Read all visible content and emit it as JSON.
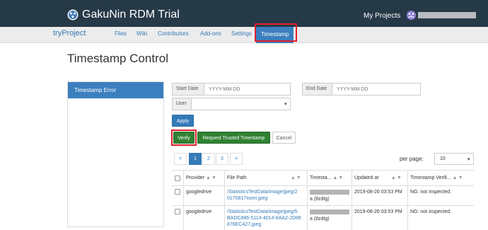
{
  "navbar": {
    "brand": "GakuNin RDM Trial",
    "my_projects": "My Projects",
    "user_name": ""
  },
  "subnav": {
    "project": "tryProject",
    "items": [
      "Files",
      "Wiki",
      "Contributors",
      "Add-ons",
      "Settings",
      "Timestamp"
    ],
    "active": "Timestamp"
  },
  "page": {
    "title": "Timestamp Control"
  },
  "sidebar": {
    "items": [
      {
        "label": "Timestamp Error"
      }
    ]
  },
  "filters": {
    "start_date_label": "Start Date",
    "start_date_placeholder": "YYYY-MM-DD",
    "end_date_label": "End Date",
    "end_date_placeholder": "YYYY-MM-DD",
    "user_label": "User",
    "user_value": ""
  },
  "buttons": {
    "apply": "Apply",
    "verify": "Verify",
    "request": "Request Trusted Timestamp",
    "cancel": "Cancel"
  },
  "pagination": {
    "prev": "<",
    "pages": [
      "1",
      "2",
      "3"
    ],
    "active_page": "1",
    "next": ">",
    "per_page_label": "per page:",
    "per_page_value": "10"
  },
  "table": {
    "headers": [
      "Provider",
      "File Path",
      "Timesta...",
      "Updated at",
      "Timestamp Verifi..."
    ],
    "rows": [
      {
        "provider": "googledrive",
        "file_path_1": "/StatisticsTestData/image/jpeg/2",
        "file_path_2": "0170817xomi.jpeg",
        "timestamp_suffix": "a (8zdtg)",
        "updated_at": "2019-08-26 03:53 PM",
        "status": "NG: not inspected."
      },
      {
        "provider": "googledrive",
        "file_path_1": "/StatisticsTestData/image/jpeg/5",
        "file_path_2": "BADC886-5114-4014-8AA2-2D86",
        "file_path_3": "876EC427.jpeg",
        "timestamp_suffix": "a (8zdtg)",
        "updated_at": "2019-08-26 03:53 PM",
        "status": "NG: not inspected."
      }
    ]
  },
  "colors": {
    "navbar": "#263947",
    "accent": "#337ab7",
    "active_tab": "#3b7fbf",
    "success": "#2f8132",
    "highlight": "#e0202e"
  },
  "icons": {
    "brand": "gakunin-logo-icon",
    "avatar": "user-avatar-icon",
    "sort": "sort-arrows-icon",
    "dropdown": "chevron-down-icon"
  }
}
